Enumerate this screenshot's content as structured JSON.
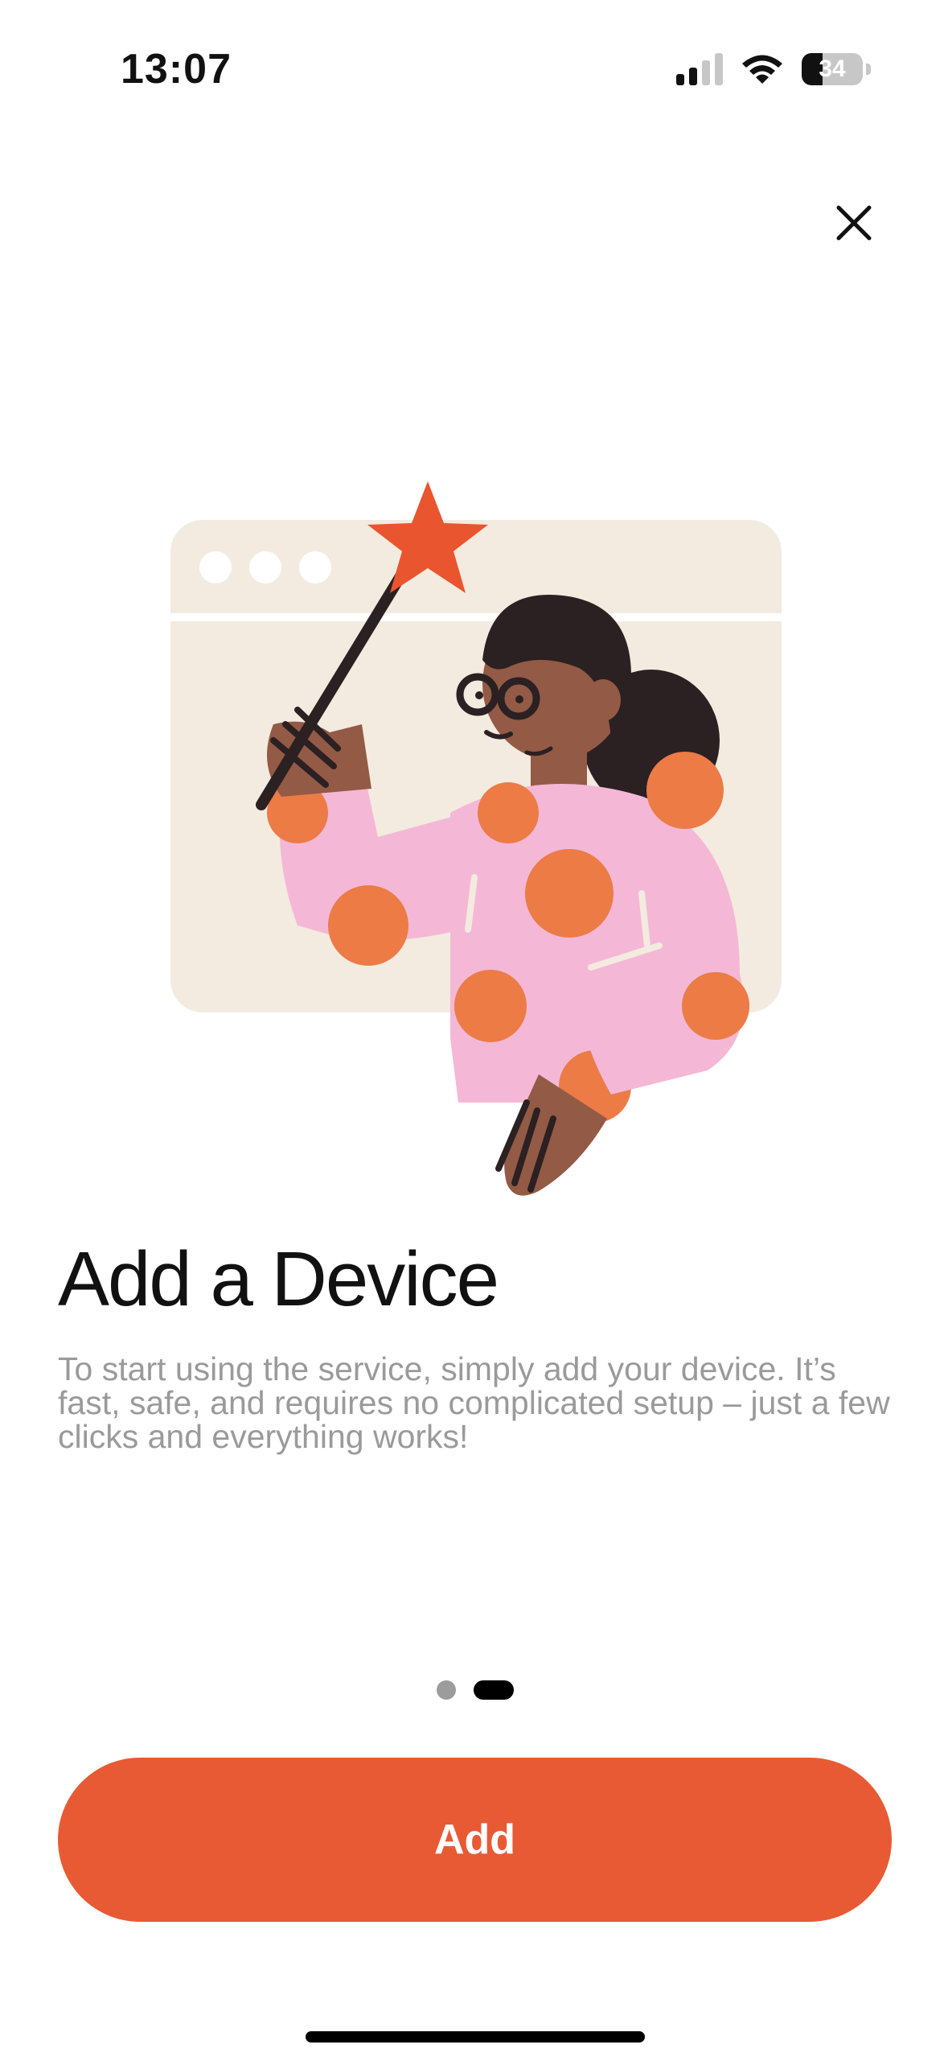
{
  "status_bar": {
    "time": "13:07",
    "battery_level": "34",
    "battery_fraction": 0.34,
    "icons": [
      "cellular-signal-icon",
      "wifi-icon",
      "battery-icon"
    ]
  },
  "header": {
    "close_icon": "close-icon"
  },
  "main": {
    "title": "Add a Device",
    "description": "To start using the service, simply add your device. It’s fast, safe, and requires no complicated setup – just a few clicks and everything works!",
    "pager": {
      "total": 2,
      "active_index": 1
    },
    "add_label": "Add"
  },
  "colors": {
    "accent": "#E85A34",
    "illustration_window": "#F3EBDF",
    "sweater": "#F4B8D6",
    "dots": "#EC7B46",
    "skin": "#935A46",
    "hair": "#2B2022",
    "star": "#E8552F",
    "description_text": "#9A9A9A"
  }
}
